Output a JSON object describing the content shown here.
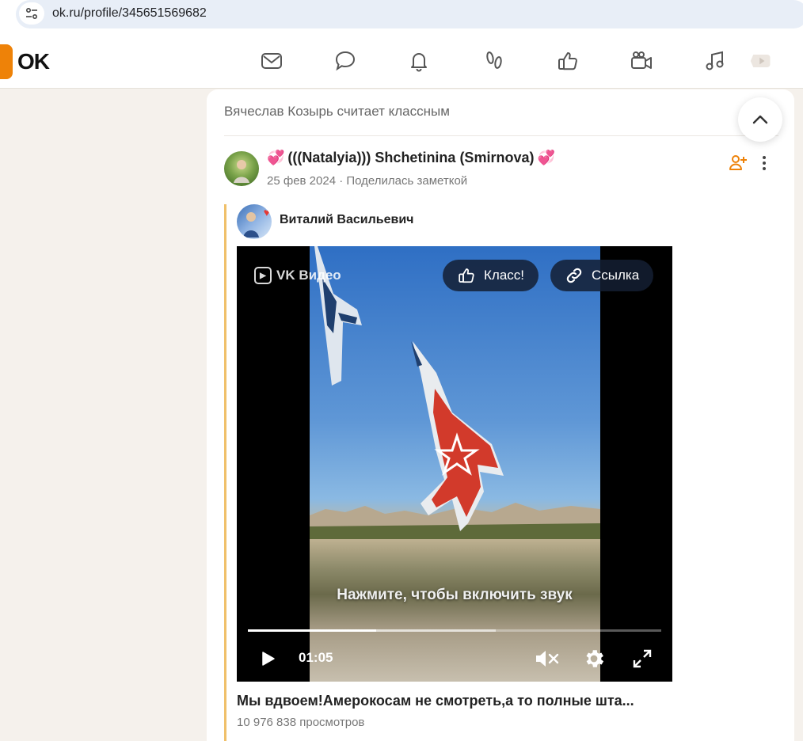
{
  "browser": {
    "url": "ok.ru/profile/345651569682"
  },
  "header": {
    "logo_text": "OK",
    "nav_icons": [
      "mail-icon",
      "chat-icon",
      "bell-icon",
      "footprints-icon",
      "thumbs-up-icon",
      "video-camera-icon",
      "music-icon",
      "video-play-icon"
    ],
    "accent_color": "#ee8208"
  },
  "feed": {
    "activity_text": "Вячеслав Козырь считает классным",
    "post": {
      "author": "(((Natalyia))) Shchetinina (Smirnova)",
      "date": "25 фев 2024",
      "action": "Поделилась заметкой",
      "reshared_author": "Виталий Васильевич",
      "video": {
        "source_label": "VK Видео",
        "like_label": "Класс!",
        "link_label": "Ссылка",
        "sound_hint": "Нажмите, чтобы включить звук",
        "time": "01:05",
        "progress_played": 0.31,
        "progress_buffered": 0.6
      },
      "video_title": "Мы вдвоем!Амерокосам не смотреть,а то полные шта...",
      "views": "10 976 838 просмотров"
    }
  }
}
